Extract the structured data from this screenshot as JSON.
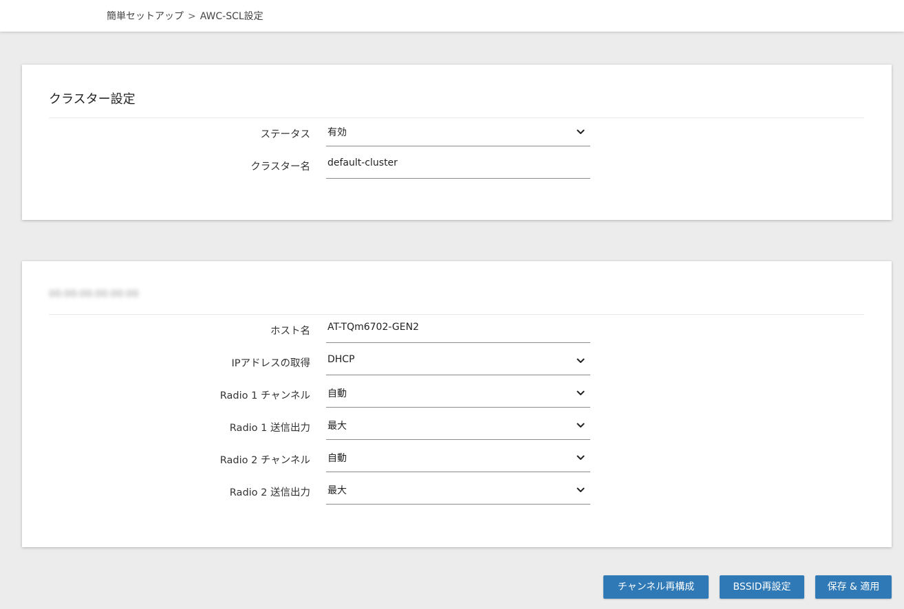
{
  "breadcrumb": {
    "root": "簡単セットアップ",
    "separator": ">",
    "current": "AWC-SCL設定"
  },
  "cluster_card": {
    "title": "クラスター設定",
    "fields": {
      "status": {
        "label": "ステータス",
        "value": "有効",
        "type": "select"
      },
      "cluster_name": {
        "label": "クラスター名",
        "value": "default-cluster",
        "type": "text"
      }
    }
  },
  "device_card": {
    "title": "00:00:00:00:00:00",
    "fields": {
      "hostname": {
        "label": "ホスト名",
        "value": "AT-TQm6702-GEN2",
        "type": "text"
      },
      "ip_mode": {
        "label": "IPアドレスの取得",
        "value": "DHCP",
        "type": "select"
      },
      "radio1_channel": {
        "label": "Radio 1 チャンネル",
        "value": "自動",
        "type": "select"
      },
      "radio1_power": {
        "label": "Radio 1 送信出力",
        "value": "最大",
        "type": "select"
      },
      "radio2_channel": {
        "label": "Radio 2 チャンネル",
        "value": "自動",
        "type": "select"
      },
      "radio2_power": {
        "label": "Radio 2 送信出力",
        "value": "最大",
        "type": "select"
      }
    }
  },
  "actions": {
    "channel_rebuild": "チャンネル再構成",
    "bssid_reset": "BSSID再設定",
    "save_apply": "保存 & 適用"
  },
  "colors": {
    "background": "#ececec",
    "card": "#ffffff",
    "button": "#2f79b7",
    "button_text": "#ffffff",
    "field_underline": "#8a8a8a"
  },
  "icons": {
    "select_arrow": "chevron-down-icon"
  }
}
